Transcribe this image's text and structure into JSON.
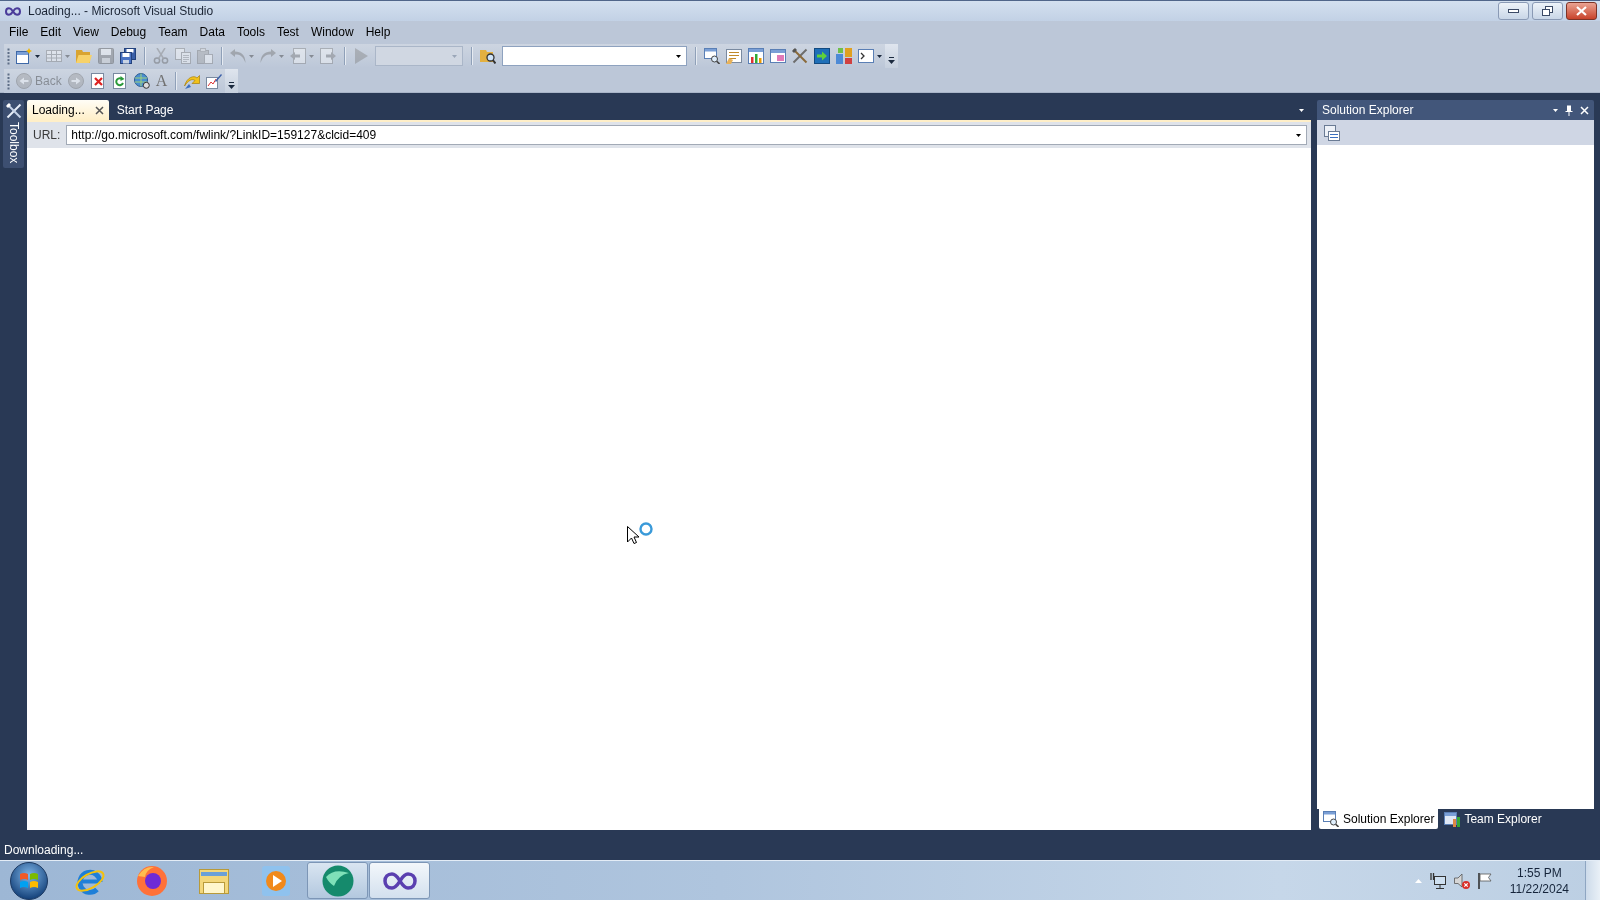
{
  "window": {
    "title": "Loading... - Microsoft Visual Studio"
  },
  "menu": [
    "File",
    "Edit",
    "View",
    "Debug",
    "Team",
    "Data",
    "Tools",
    "Test",
    "Window",
    "Help"
  ],
  "toolbars": [
    {
      "items": [
        {
          "kind": "button",
          "disabled": false,
          "dropdown": true
        },
        {
          "kind": "button",
          "disabled": true,
          "dropdown": true
        },
        {
          "kind": "button",
          "disabled": false,
          "dropdown": false
        },
        {
          "kind": "button",
          "disabled": true,
          "dropdown": false
        },
        {
          "kind": "button",
          "disabled": false,
          "dropdown": false
        },
        {
          "kind": "separator"
        },
        {
          "kind": "button",
          "disabled": true,
          "dropdown": false
        },
        {
          "kind": "button",
          "disabled": true,
          "dropdown": false
        },
        {
          "kind": "button",
          "disabled": true,
          "dropdown": false
        },
        {
          "kind": "separator"
        },
        {
          "kind": "button",
          "disabled": true,
          "dropdown": true
        },
        {
          "kind": "button",
          "disabled": true,
          "dropdown": true
        },
        {
          "kind": "button",
          "disabled": true,
          "dropdown": true
        },
        {
          "kind": "button",
          "disabled": true,
          "dropdown": false
        },
        {
          "kind": "separator"
        },
        {
          "kind": "button",
          "disabled": true,
          "dropdown": false
        },
        {
          "kind": "combo",
          "disabled": true
        },
        {
          "kind": "separator"
        },
        {
          "kind": "button",
          "disabled": false,
          "dropdown": false
        },
        {
          "kind": "combo",
          "disabled": false
        },
        {
          "kind": "separator"
        },
        {
          "kind": "button",
          "disabled": false,
          "dropdown": false
        },
        {
          "kind": "button",
          "disabled": false,
          "dropdown": false
        },
        {
          "kind": "button",
          "disabled": false,
          "dropdown": false
        },
        {
          "kind": "button",
          "disabled": false,
          "dropdown": false
        },
        {
          "kind": "button",
          "disabled": false,
          "dropdown": false
        },
        {
          "kind": "button",
          "disabled": false,
          "dropdown": false
        },
        {
          "kind": "button",
          "disabled": false,
          "dropdown": false
        },
        {
          "kind": "button",
          "disabled": false,
          "dropdown": true
        }
      ]
    },
    {
      "items": [
        {
          "kind": "button",
          "label": "Back",
          "disabled": true,
          "dropdown": false
        },
        {
          "kind": "button",
          "disabled": true,
          "dropdown": false
        },
        {
          "kind": "button",
          "disabled": false,
          "dropdown": false
        },
        {
          "kind": "button",
          "disabled": false,
          "dropdown": false
        },
        {
          "kind": "button",
          "disabled": false,
          "dropdown": false
        },
        {
          "kind": "button",
          "label": "A",
          "disabled": false,
          "dropdown": false
        },
        {
          "kind": "separator"
        },
        {
          "kind": "button",
          "disabled": false,
          "dropdown": false
        },
        {
          "kind": "button",
          "disabled": false,
          "dropdown": false
        }
      ]
    }
  ],
  "toolbox": {
    "label": "Toolbox"
  },
  "document_tabs": [
    {
      "label": "Loading...",
      "selected": true
    },
    {
      "label": "Start Page",
      "selected": false
    }
  ],
  "url_bar": {
    "label": "URL:",
    "value": "http://go.microsoft.com/fwlink/?LinkID=159127&clcid=409"
  },
  "solution_explorer": {
    "title": "Solution Explorer",
    "tabs": [
      {
        "label": "Solution Explorer",
        "selected": true
      },
      {
        "label": "Team Explorer",
        "selected": false
      }
    ]
  },
  "status_bar": {
    "text": "Downloading..."
  },
  "taskbar": {
    "apps": [
      {
        "running": false,
        "active": false
      },
      {
        "running": false,
        "active": false
      },
      {
        "running": false,
        "active": false
      },
      {
        "running": false,
        "active": false
      },
      {
        "running": true,
        "active": false
      },
      {
        "running": true,
        "active": true
      }
    ],
    "clock": {
      "time": "1:55 PM",
      "date": "11/22/2024"
    }
  }
}
